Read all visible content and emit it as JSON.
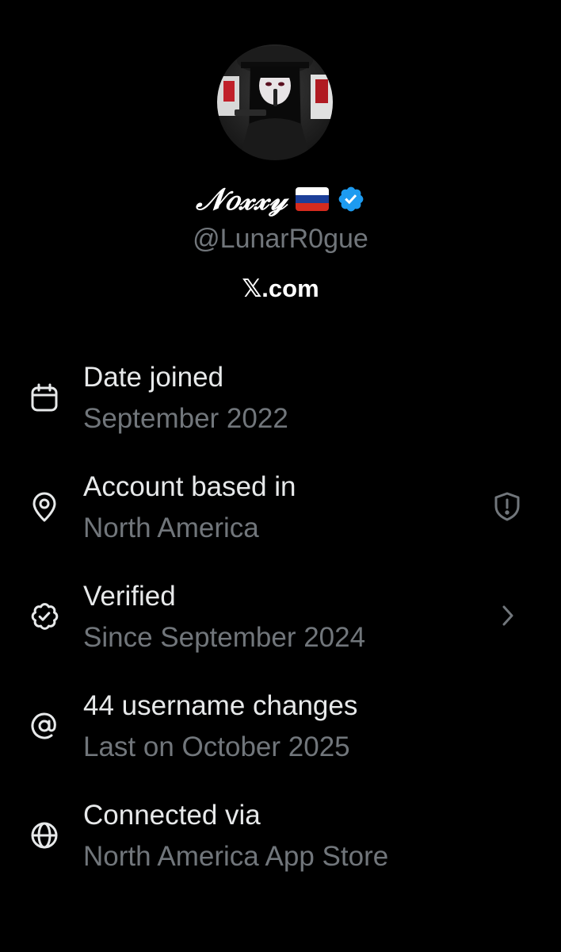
{
  "profile": {
    "display_name": "𝒩𝑜𝓍𝓍𝓎",
    "handle": "@LunarR0gue",
    "site": "𝕏.com",
    "flag_icon": "russia-flag-icon",
    "verified_icon": "verified-badge-icon",
    "verified_color": "#1d9bf0"
  },
  "info": {
    "rows": [
      {
        "icon": "calendar-icon",
        "title": "Date joined",
        "subtitle": "September 2022",
        "trailing": ""
      },
      {
        "icon": "location-pin-icon",
        "title": "Account based in",
        "subtitle": "North America",
        "trailing": "shield-alert-icon"
      },
      {
        "icon": "verified-check-icon",
        "title": "Verified",
        "subtitle": "Since September 2024",
        "trailing": "chevron-right-icon"
      },
      {
        "icon": "at-sign-icon",
        "title": "44 username changes",
        "subtitle": "Last on October 2025",
        "trailing": ""
      },
      {
        "icon": "globe-icon",
        "title": "Connected via",
        "subtitle": "North America App Store",
        "trailing": ""
      }
    ]
  },
  "colors": {
    "background": "#000000",
    "primary_text": "#e7e9ea",
    "secondary_text": "#71767b",
    "icon": "#e7e9ea"
  }
}
